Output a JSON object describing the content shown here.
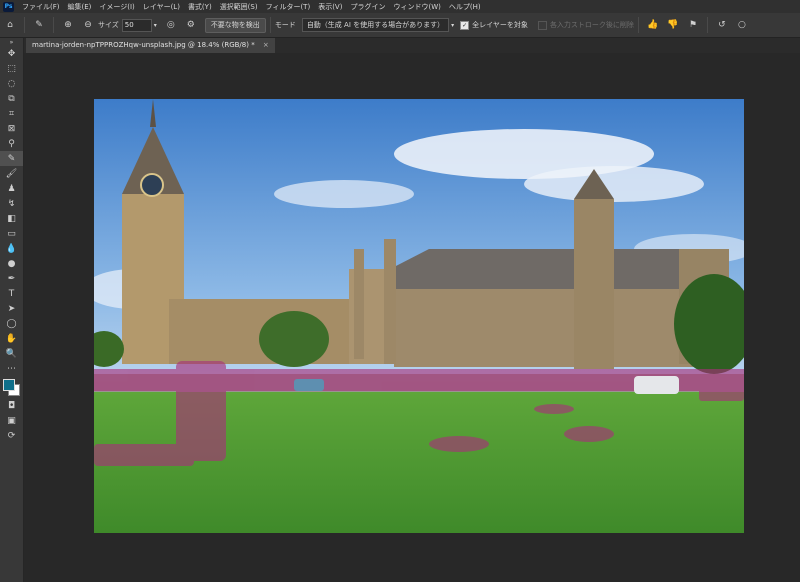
{
  "app": {
    "logo": "Ps"
  },
  "menu": [
    "ファイル(F)",
    "編集(E)",
    "イメージ(I)",
    "レイヤー(L)",
    "書式(Y)",
    "選択範囲(S)",
    "フィルター(T)",
    "表示(V)",
    "プラグイン",
    "ウィンドウ(W)",
    "ヘルプ(H)"
  ],
  "options": {
    "size_label": "サイズ",
    "size_value": "50",
    "remove_button": "不要な物を検出",
    "mode_label": "モード",
    "mode_value": "自動（生成 AI を使用する場合があります）",
    "all_layers_label": "全レイヤーを対象",
    "stroke_label": "各入力ストローク後に削除"
  },
  "document": {
    "tab_title": "martina-jorden-npTPPROZHqw-unsplash.jpg @ 18.4% (RGB/8) *",
    "close": "×"
  },
  "tools": [
    "move-icon",
    "marquee-icon",
    "lasso-icon",
    "object-select-icon",
    "crop-icon",
    "frame-icon",
    "eyedropper-icon",
    "remove-tool-icon",
    "brush-icon",
    "stamp-icon",
    "history-brush-icon",
    "eraser-icon",
    "gradient-icon",
    "blur-icon",
    "dodge-icon",
    "pen-icon",
    "type-icon",
    "path-select-icon",
    "shape-icon",
    "hand-icon",
    "zoom-icon",
    "more-icon"
  ],
  "colors": {
    "foreground": "#0f6f8a",
    "background": "#ffffff",
    "highlight": "#a8307a"
  }
}
